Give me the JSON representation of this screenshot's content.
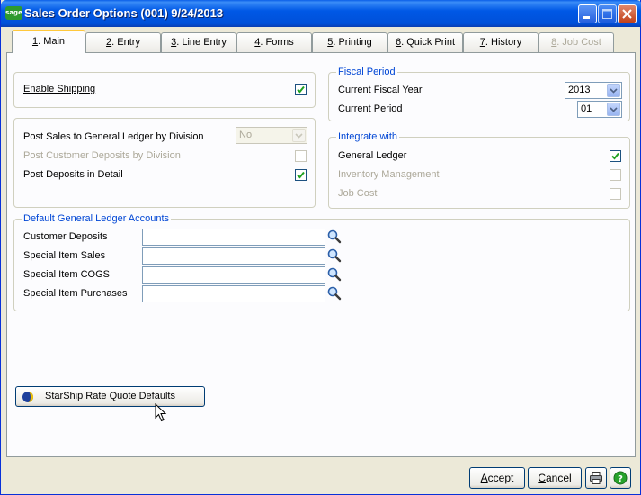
{
  "window": {
    "title": "Sales Order Options (001) 9/24/2013",
    "app_logo": "sage"
  },
  "tabs": [
    {
      "num": "1",
      "label": ". Main",
      "active": true,
      "enabled": true
    },
    {
      "num": "2",
      "label": ". Entry",
      "active": false,
      "enabled": true
    },
    {
      "num": "3",
      "label": ". Line Entry",
      "active": false,
      "enabled": true
    },
    {
      "num": "4",
      "label": ". Forms",
      "active": false,
      "enabled": true
    },
    {
      "num": "5",
      "label": ". Printing",
      "active": false,
      "enabled": true
    },
    {
      "num": "6",
      "label": ". Quick Print",
      "active": false,
      "enabled": true
    },
    {
      "num": "7",
      "label": ". History",
      "active": false,
      "enabled": true
    },
    {
      "num": "8",
      "label": ". Job Cost",
      "active": false,
      "enabled": false
    }
  ],
  "shipping": {
    "enable_shipping_label": "Enable Shipping",
    "enable_shipping_checked": true
  },
  "gl_posting": {
    "post_by_division_label": "Post Sales to General Ledger by Division",
    "post_by_division_value": "No",
    "post_deposits_by_division_label": "Post Customer Deposits by Division",
    "post_deposits_by_division_checked": false,
    "post_deposits_detail_label": "Post Deposits in Detail",
    "post_deposits_detail_checked": true
  },
  "fiscal_period": {
    "legend": "Fiscal Period",
    "year_label": "Current Fiscal Year",
    "year_value": "2013",
    "period_label": "Current Period",
    "period_value": "01"
  },
  "integrate_with": {
    "legend": "Integrate with",
    "items": [
      {
        "label": "General Ledger",
        "checked": true,
        "enabled": true
      },
      {
        "label": "Inventory Management",
        "checked": false,
        "enabled": false
      },
      {
        "label": "Job Cost",
        "checked": false,
        "enabled": false
      }
    ]
  },
  "default_gl_accounts": {
    "legend": "Default General Ledger Accounts",
    "fields": [
      {
        "label": "Customer Deposits",
        "value": ""
      },
      {
        "label": "Special Item Sales",
        "value": ""
      },
      {
        "label": "Special Item COGS",
        "value": ""
      },
      {
        "label": "Special Item Purchases",
        "value": ""
      }
    ]
  },
  "starship_button_label": "StarShip Rate Quote Defaults",
  "footer": {
    "accept_hot": "A",
    "accept_rest": "ccept",
    "cancel_hot": "C",
    "cancel_rest": "ancel",
    "print_icon": "printer-icon",
    "help_icon": "help-icon"
  },
  "colors": {
    "titlebar": "#0058e6",
    "legend_text": "#0046d5",
    "active_tab_highlight": "#ffc83c",
    "check_mark": "#21a121"
  }
}
